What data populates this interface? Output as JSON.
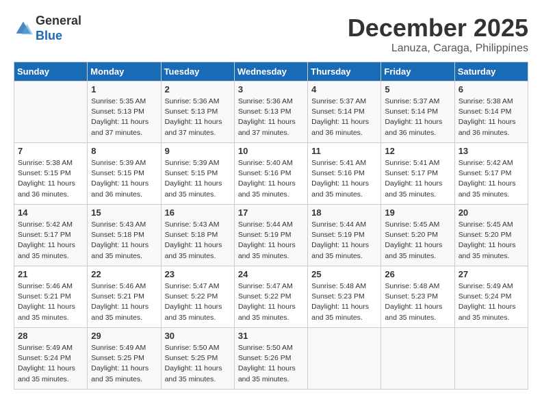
{
  "header": {
    "logo_general": "General",
    "logo_blue": "Blue",
    "month_title": "December 2025",
    "location": "Lanuza, Caraga, Philippines"
  },
  "days_of_week": [
    "Sunday",
    "Monday",
    "Tuesday",
    "Wednesday",
    "Thursday",
    "Friday",
    "Saturday"
  ],
  "weeks": [
    [
      {
        "day": "",
        "info": ""
      },
      {
        "day": "1",
        "info": "Sunrise: 5:35 AM\nSunset: 5:13 PM\nDaylight: 11 hours\nand 37 minutes."
      },
      {
        "day": "2",
        "info": "Sunrise: 5:36 AM\nSunset: 5:13 PM\nDaylight: 11 hours\nand 37 minutes."
      },
      {
        "day": "3",
        "info": "Sunrise: 5:36 AM\nSunset: 5:13 PM\nDaylight: 11 hours\nand 37 minutes."
      },
      {
        "day": "4",
        "info": "Sunrise: 5:37 AM\nSunset: 5:14 PM\nDaylight: 11 hours\nand 36 minutes."
      },
      {
        "day": "5",
        "info": "Sunrise: 5:37 AM\nSunset: 5:14 PM\nDaylight: 11 hours\nand 36 minutes."
      },
      {
        "day": "6",
        "info": "Sunrise: 5:38 AM\nSunset: 5:14 PM\nDaylight: 11 hours\nand 36 minutes."
      }
    ],
    [
      {
        "day": "7",
        "info": "Sunrise: 5:38 AM\nSunset: 5:15 PM\nDaylight: 11 hours\nand 36 minutes."
      },
      {
        "day": "8",
        "info": "Sunrise: 5:39 AM\nSunset: 5:15 PM\nDaylight: 11 hours\nand 36 minutes."
      },
      {
        "day": "9",
        "info": "Sunrise: 5:39 AM\nSunset: 5:15 PM\nDaylight: 11 hours\nand 35 minutes."
      },
      {
        "day": "10",
        "info": "Sunrise: 5:40 AM\nSunset: 5:16 PM\nDaylight: 11 hours\nand 35 minutes."
      },
      {
        "day": "11",
        "info": "Sunrise: 5:41 AM\nSunset: 5:16 PM\nDaylight: 11 hours\nand 35 minutes."
      },
      {
        "day": "12",
        "info": "Sunrise: 5:41 AM\nSunset: 5:17 PM\nDaylight: 11 hours\nand 35 minutes."
      },
      {
        "day": "13",
        "info": "Sunrise: 5:42 AM\nSunset: 5:17 PM\nDaylight: 11 hours\nand 35 minutes."
      }
    ],
    [
      {
        "day": "14",
        "info": "Sunrise: 5:42 AM\nSunset: 5:17 PM\nDaylight: 11 hours\nand 35 minutes."
      },
      {
        "day": "15",
        "info": "Sunrise: 5:43 AM\nSunset: 5:18 PM\nDaylight: 11 hours\nand 35 minutes."
      },
      {
        "day": "16",
        "info": "Sunrise: 5:43 AM\nSunset: 5:18 PM\nDaylight: 11 hours\nand 35 minutes."
      },
      {
        "day": "17",
        "info": "Sunrise: 5:44 AM\nSunset: 5:19 PM\nDaylight: 11 hours\nand 35 minutes."
      },
      {
        "day": "18",
        "info": "Sunrise: 5:44 AM\nSunset: 5:19 PM\nDaylight: 11 hours\nand 35 minutes."
      },
      {
        "day": "19",
        "info": "Sunrise: 5:45 AM\nSunset: 5:20 PM\nDaylight: 11 hours\nand 35 minutes."
      },
      {
        "day": "20",
        "info": "Sunrise: 5:45 AM\nSunset: 5:20 PM\nDaylight: 11 hours\nand 35 minutes."
      }
    ],
    [
      {
        "day": "21",
        "info": "Sunrise: 5:46 AM\nSunset: 5:21 PM\nDaylight: 11 hours\nand 35 minutes."
      },
      {
        "day": "22",
        "info": "Sunrise: 5:46 AM\nSunset: 5:21 PM\nDaylight: 11 hours\nand 35 minutes."
      },
      {
        "day": "23",
        "info": "Sunrise: 5:47 AM\nSunset: 5:22 PM\nDaylight: 11 hours\nand 35 minutes."
      },
      {
        "day": "24",
        "info": "Sunrise: 5:47 AM\nSunset: 5:22 PM\nDaylight: 11 hours\nand 35 minutes."
      },
      {
        "day": "25",
        "info": "Sunrise: 5:48 AM\nSunset: 5:23 PM\nDaylight: 11 hours\nand 35 minutes."
      },
      {
        "day": "26",
        "info": "Sunrise: 5:48 AM\nSunset: 5:23 PM\nDaylight: 11 hours\nand 35 minutes."
      },
      {
        "day": "27",
        "info": "Sunrise: 5:49 AM\nSunset: 5:24 PM\nDaylight: 11 hours\nand 35 minutes."
      }
    ],
    [
      {
        "day": "28",
        "info": "Sunrise: 5:49 AM\nSunset: 5:24 PM\nDaylight: 11 hours\nand 35 minutes."
      },
      {
        "day": "29",
        "info": "Sunrise: 5:49 AM\nSunset: 5:25 PM\nDaylight: 11 hours\nand 35 minutes."
      },
      {
        "day": "30",
        "info": "Sunrise: 5:50 AM\nSunset: 5:25 PM\nDaylight: 11 hours\nand 35 minutes."
      },
      {
        "day": "31",
        "info": "Sunrise: 5:50 AM\nSunset: 5:26 PM\nDaylight: 11 hours\nand 35 minutes."
      },
      {
        "day": "",
        "info": ""
      },
      {
        "day": "",
        "info": ""
      },
      {
        "day": "",
        "info": ""
      }
    ]
  ]
}
